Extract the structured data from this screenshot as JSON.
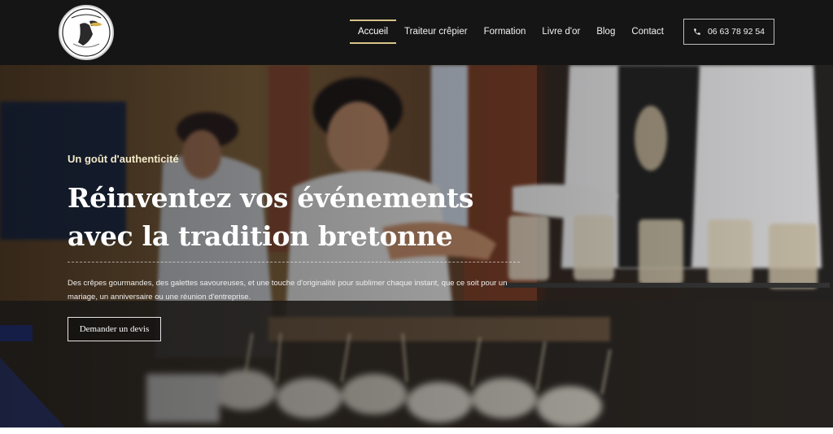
{
  "header": {
    "logo_alt": "Logo",
    "nav": [
      {
        "label": "Accueil",
        "active": true
      },
      {
        "label": "Traiteur crêpier",
        "active": false
      },
      {
        "label": "Formation",
        "active": false
      },
      {
        "label": "Livre d'or",
        "active": false
      },
      {
        "label": "Blog",
        "active": false
      },
      {
        "label": "Contact",
        "active": false
      }
    ],
    "phone": {
      "icon": "phone-icon",
      "label": "06 63 78 92 54"
    }
  },
  "hero": {
    "kicker": "Un goût d'authenticité",
    "title_line1": "Réinventez vos événements",
    "title_line2": "avec la tradition bretonne",
    "description": "Des crêpes gourmandes, des galettes savoureuses, et une touche d'originalité pour sublimer chaque instant, que ce soit pour un mariage, un anniversaire ou une réunion d'entreprise.",
    "cta_label": "Demander un devis"
  },
  "colors": {
    "accent": "#d6c48a",
    "header_bg": "#151515",
    "text": "#ffffff"
  }
}
